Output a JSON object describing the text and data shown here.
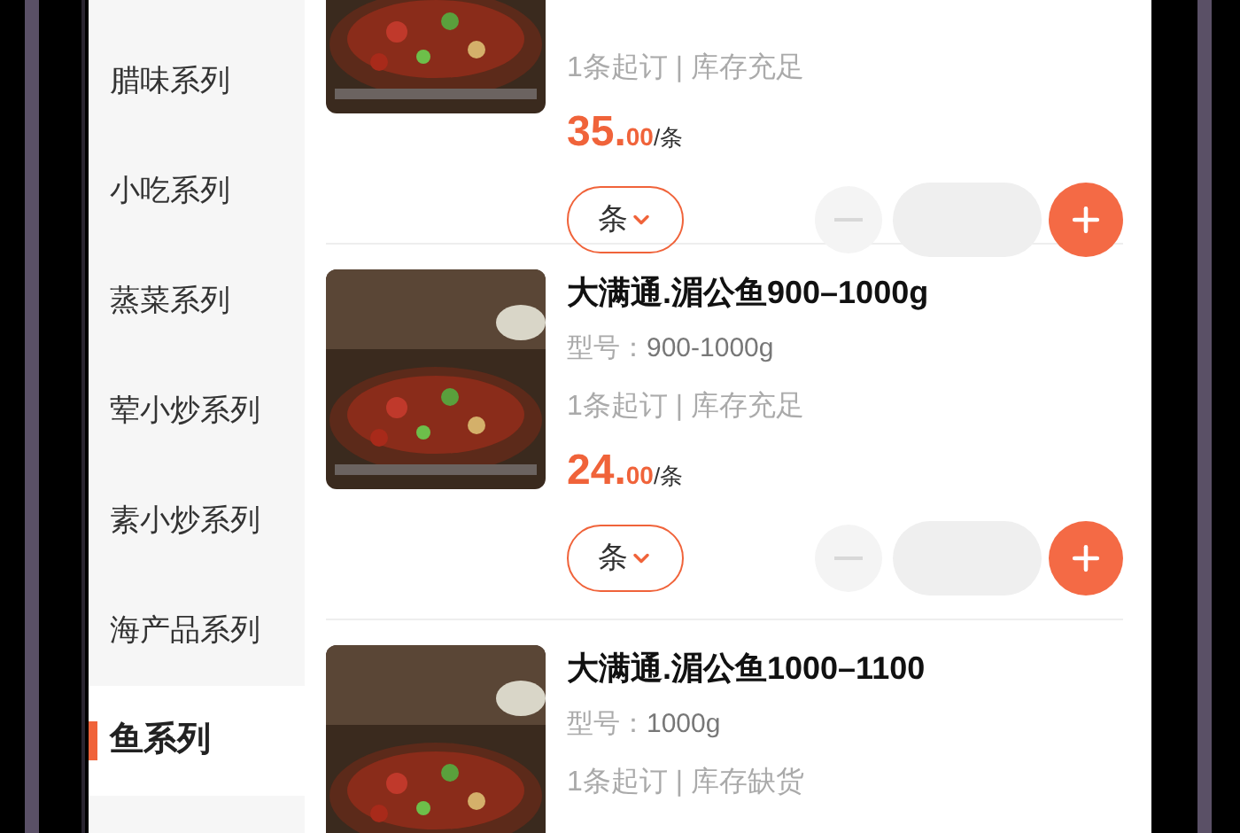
{
  "categories": [
    {
      "label": "腊味系列",
      "selected": false
    },
    {
      "label": "小吃系列",
      "selected": false
    },
    {
      "label": "蒸菜系列",
      "selected": false
    },
    {
      "label": "荤小炒系列",
      "selected": false
    },
    {
      "label": "素小炒系列",
      "selected": false
    },
    {
      "label": "海产品系列",
      "selected": false
    },
    {
      "label": "鱼系列",
      "selected": true
    }
  ],
  "products": [
    {
      "stock_line": "1条起订 | 库存充足",
      "price_integer": "35.",
      "price_decimal": "00",
      "price_unit": "/条",
      "unit_select": "条"
    },
    {
      "title": "大满通.湄公鱼900–1000g",
      "model_label": "型号：",
      "model": "900-1000g",
      "stock_line": "1条起订 | 库存充足",
      "price_integer": "24.",
      "price_decimal": "00",
      "price_unit": "/条",
      "unit_select": "条"
    },
    {
      "title": "大满通.湄公鱼1000–1100",
      "model_label": "型号：",
      "model": "1000g",
      "stock_line": "1条起订 | 库存缺货"
    }
  ]
}
